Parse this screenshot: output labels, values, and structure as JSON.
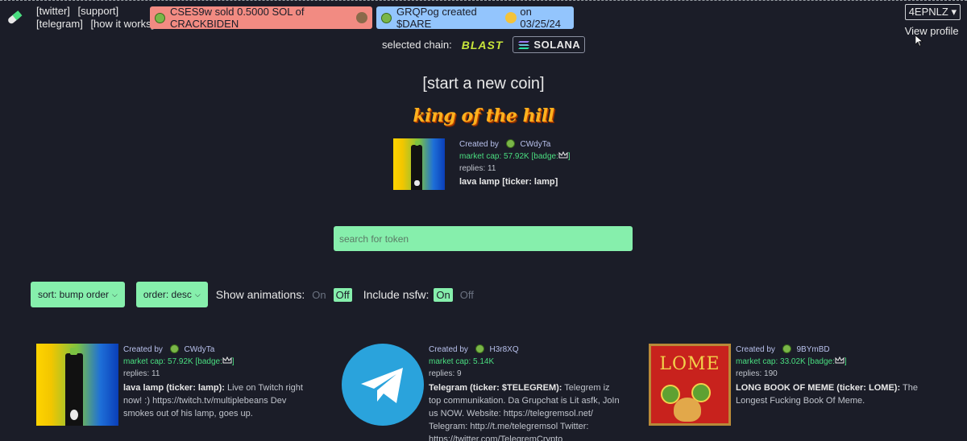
{
  "nav": {
    "twitter": "[twitter]",
    "support": "[support]",
    "telegram": "[telegram]",
    "how_it_works": "[how it works]"
  },
  "ticker": {
    "sold": "CSES9w sold 0.5000 SOL of CRACKBIDEN",
    "created": "GRQPog created $DARE",
    "created_date": "on 03/25/24"
  },
  "profile": {
    "wallet": "4EPNLZ",
    "wallet_chevron": "▾",
    "view": "View profile"
  },
  "chain": {
    "label": "selected chain:",
    "blast": "BLAST",
    "solana": "SOLANA"
  },
  "start_coin": "[start a new coin]",
  "king_of_hill": "king of the hill",
  "king_coin": {
    "created_by": "Created by",
    "creator": "CWdyTa",
    "market_cap": "market cap: 57.92K",
    "badge": "[badge:",
    "badge_end": "]",
    "replies": "replies: 11",
    "title": "lava lamp [ticker: lamp]"
  },
  "search": {
    "placeholder": "search for token"
  },
  "controls": {
    "sort": "sort: bump order",
    "order": "order: desc",
    "show_animations": "Show animations:",
    "anim_on": "On",
    "anim_off": "Off",
    "include_nsfw": "Include nsfw:",
    "nsfw_on": "On",
    "nsfw_off": "Off"
  },
  "cards": [
    {
      "created_by": "Created by",
      "creator": "CWdyTa",
      "market_cap": "market cap: 57.92K",
      "badge": "[badge:",
      "badge_end": "]",
      "replies": "replies: 11",
      "title": "lava lamp (ticker: lamp):",
      "desc": " Live on Twitch right now! :) https://twitch.tv/multiplebeans Dev smokes out of his lamp, goes up."
    },
    {
      "created_by": "Created by",
      "creator": "H3r8XQ",
      "market_cap": "market cap: 5.14K",
      "replies": "replies: 9",
      "title": "Telegram (ticker: $TELEGREM):",
      "desc": " Telegrem iz top communikation. Da Grupchat is Lit asfk, JoIn us NOW. Website: https://telegremsol.net/ Telegram: http://t.me/telegremsol Twitter: https://twitter.com/TelegremCrypto"
    },
    {
      "created_by": "Created by",
      "creator": "9BYmBD",
      "market_cap": "market cap: 33.02K",
      "badge": "[badge:",
      "badge_end": "]",
      "replies": "replies: 190",
      "title": "LONG BOOK OF MEME (ticker: LOME):",
      "desc": " The Longest Fucking Book Of Meme.",
      "image_text": "LOME"
    }
  ],
  "colors": {
    "background": "#1b1d28",
    "accent_green": "#86efac",
    "market_cap_green": "#4ade80",
    "sold_red": "#f28b82",
    "created_blue": "#93c5fd"
  }
}
